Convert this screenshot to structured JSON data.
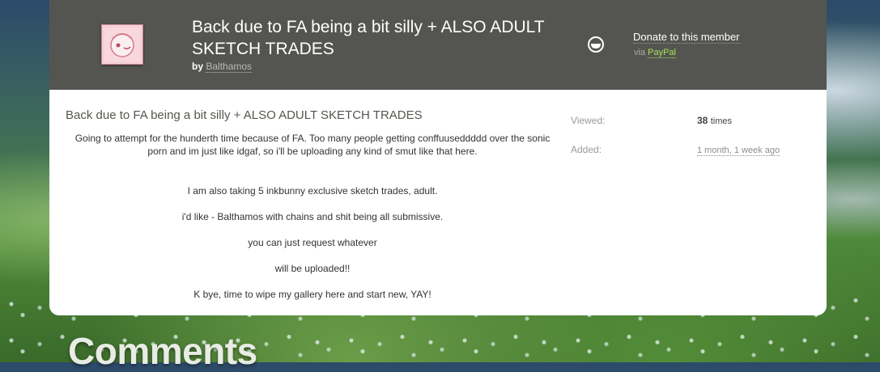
{
  "submission": {
    "title": "Back due to FA being a bit silly + ALSO ADULT SKETCH TRADES",
    "by_label": "by",
    "author": "Balthamos"
  },
  "donate": {
    "link_label": "Donate to this member",
    "via_label": "via",
    "provider": "PayPal",
    "icon": "smiley-face-icon"
  },
  "content": {
    "title": "Back due to FA being a bit silly + ALSO ADULT SKETCH TRADES",
    "paragraphs": [
      "Going to attempt for the hunderth time because of FA. Too many people getting conffuuseddddd over the sonic porn and im just like idgaf, so i'll be uploading any kind of smut like that here.",
      "I am also taking 5 inkbunny exclusive sketch trades, adult.",
      "i'd like - Balthamos with chains and shit being all submissive.",
      "you can just request whatever",
      "will be uploaded!!",
      "K bye, time to wipe my gallery here and start new, YAY!"
    ]
  },
  "stats": {
    "viewed_label": "Viewed:",
    "viewed_count": "38",
    "viewed_unit": "times",
    "added_label": "Added:",
    "added_value": "1 month, 1 week ago"
  },
  "comments": {
    "heading": "Comments"
  },
  "colors": {
    "header_bg": "#545550",
    "card_bg": "#ffffff",
    "paypal_green": "#a6e05a"
  }
}
